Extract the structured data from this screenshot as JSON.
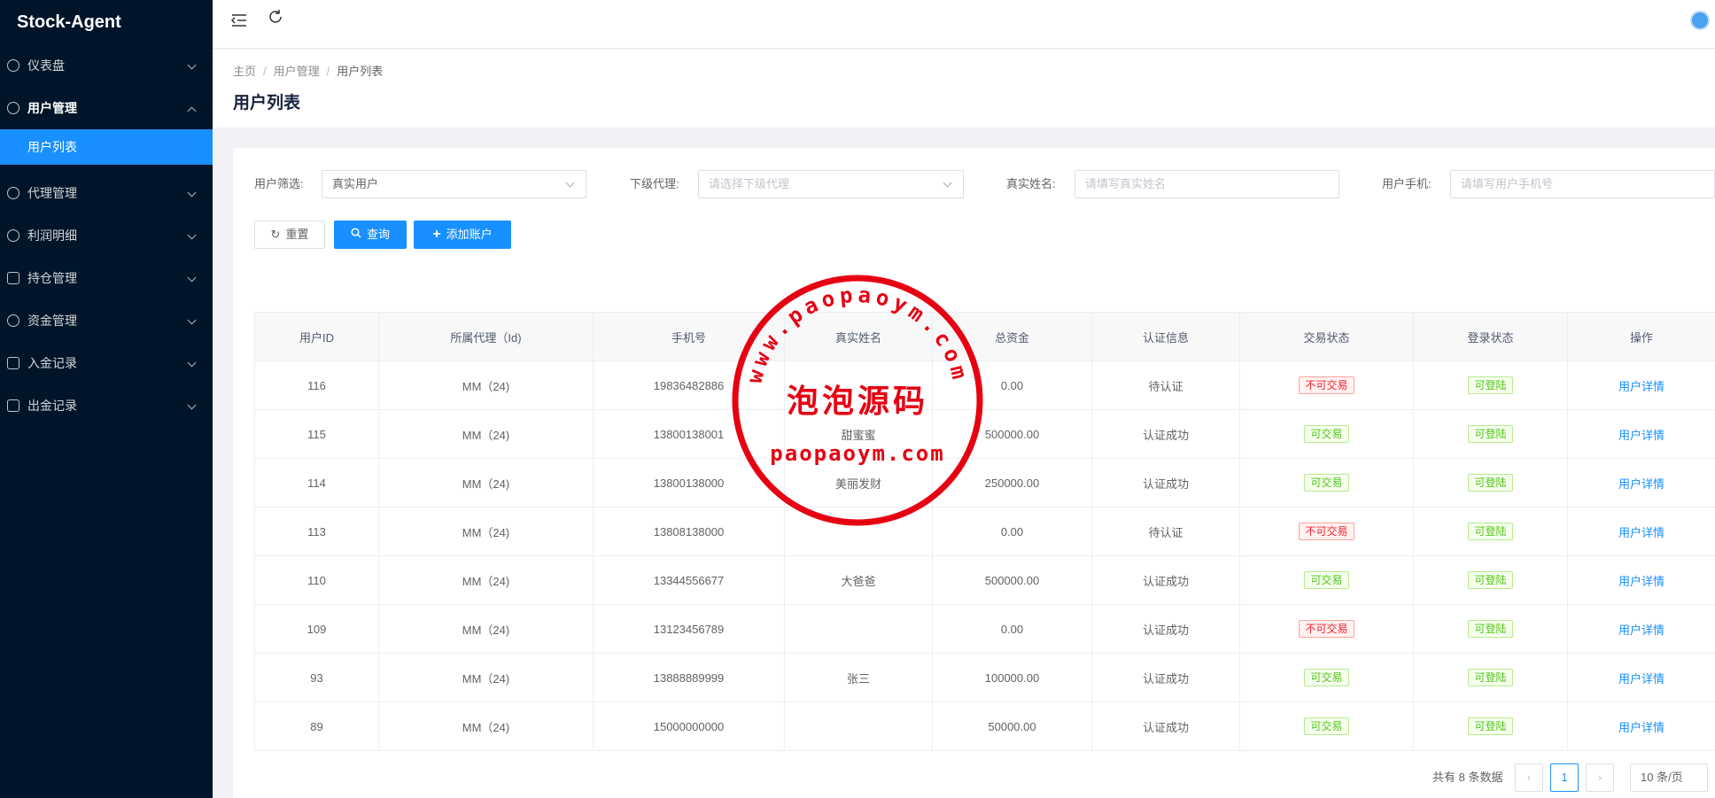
{
  "app": {
    "title": "Stock-Agent"
  },
  "sidebar": {
    "items": [
      {
        "label": "仪表盘",
        "icon": "dashboard-icon",
        "expanded": false
      },
      {
        "label": "用户管理",
        "icon": "user-icon",
        "expanded": true,
        "children": [
          {
            "label": "用户列表",
            "active": true
          }
        ]
      },
      {
        "label": "代理管理",
        "icon": "agent-icon",
        "expanded": false
      },
      {
        "label": "利润明细",
        "icon": "profit-icon",
        "expanded": false
      },
      {
        "label": "持仓管理",
        "icon": "position-icon",
        "expanded": false
      },
      {
        "label": "资金管理",
        "icon": "fund-icon",
        "expanded": false
      },
      {
        "label": "入金记录",
        "icon": "deposit-icon",
        "expanded": false
      },
      {
        "label": "出金记录",
        "icon": "withdraw-icon",
        "expanded": false
      }
    ]
  },
  "header": {
    "collapse_icon": "menu-fold-icon",
    "refresh_icon": "refresh-icon",
    "avatar_icon": "avatar-icon"
  },
  "breadcrumb": {
    "items": [
      "主页",
      "用户管理",
      "用户列表"
    ],
    "separator": "/"
  },
  "page": {
    "title": "用户列表"
  },
  "filters": {
    "user_filter": {
      "label": "用户筛选:",
      "value": "真实用户"
    },
    "sub_agent": {
      "label": "下级代理:",
      "placeholder": "请选择下级代理"
    },
    "real_name": {
      "label": "真实姓名:",
      "placeholder": "请填写真实姓名"
    },
    "phone": {
      "label": "用户手机:",
      "placeholder": "请填写用户手机号"
    }
  },
  "buttons": {
    "reset": "重置",
    "query": "查询",
    "add": "添加账户"
  },
  "table": {
    "columns": [
      "用户ID",
      "所属代理（Id)",
      "手机号",
      "真实姓名",
      "总资金",
      "认证信息",
      "交易状态",
      "登录状态",
      "操作"
    ],
    "rows": [
      {
        "id": "116",
        "agent": "MM（24)",
        "phone": "19836482886",
        "name": "",
        "funds": "0.00",
        "auth": "待认证",
        "trade": "不可交易",
        "trade_ok": false,
        "login": "可登陆",
        "action": "用户详情"
      },
      {
        "id": "115",
        "agent": "MM（24)",
        "phone": "13800138001",
        "name": "甜蜜蜜",
        "funds": "500000.00",
        "auth": "认证成功",
        "trade": "可交易",
        "trade_ok": true,
        "login": "可登陆",
        "action": "用户详情"
      },
      {
        "id": "114",
        "agent": "MM（24)",
        "phone": "13800138000",
        "name": "美丽发财",
        "funds": "250000.00",
        "auth": "认证成功",
        "trade": "可交易",
        "trade_ok": true,
        "login": "可登陆",
        "action": "用户详情"
      },
      {
        "id": "113",
        "agent": "MM（24)",
        "phone": "13808138000",
        "name": "",
        "funds": "0.00",
        "auth": "待认证",
        "trade": "不可交易",
        "trade_ok": false,
        "login": "可登陆",
        "action": "用户详情"
      },
      {
        "id": "110",
        "agent": "MM（24)",
        "phone": "13344556677",
        "name": "大爸爸",
        "funds": "500000.00",
        "auth": "认证成功",
        "trade": "可交易",
        "trade_ok": true,
        "login": "可登陆",
        "action": "用户详情"
      },
      {
        "id": "109",
        "agent": "MM（24)",
        "phone": "13123456789",
        "name": "",
        "funds": "0.00",
        "auth": "认证成功",
        "trade": "不可交易",
        "trade_ok": false,
        "login": "可登陆",
        "action": "用户详情"
      },
      {
        "id": "93",
        "agent": "MM（24)",
        "phone": "13888889999",
        "name": "张三",
        "funds": "100000.00",
        "auth": "认证成功",
        "trade": "可交易",
        "trade_ok": true,
        "login": "可登陆",
        "action": "用户详情"
      },
      {
        "id": "89",
        "agent": "MM（24)",
        "phone": "15000000000",
        "name": "",
        "funds": "50000.00",
        "auth": "认证成功",
        "trade": "可交易",
        "trade_ok": true,
        "login": "可登陆",
        "action": "用户详情"
      }
    ]
  },
  "pagination": {
    "total_text": "共有 8 条数据",
    "current_page": "1",
    "page_size": "10 条/页",
    "prev": "‹",
    "next": "›"
  },
  "watermark": {
    "arc_text": "www.paopaoym.com",
    "center_text": "泡泡源码",
    "bottom_text": "paopaoym.com",
    "color": "#e60012"
  },
  "colors": {
    "sidebar_bg": "#001529",
    "primary": "#1890ff",
    "danger": "#f5222d",
    "success": "#52c41a"
  }
}
